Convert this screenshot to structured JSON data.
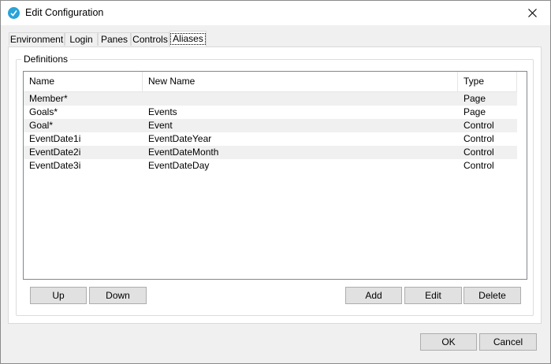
{
  "window": {
    "title": "Edit Configuration"
  },
  "tabs": [
    {
      "label": "Environment"
    },
    {
      "label": "Login"
    },
    {
      "label": "Panes"
    },
    {
      "label": "Controls"
    },
    {
      "label": "Aliases",
      "selected": true
    }
  ],
  "definitions": {
    "group_label": "Definitions",
    "columns": [
      "Name",
      "New Name",
      "Type"
    ],
    "rows": [
      {
        "name": "Member*",
        "new_name": "",
        "type": "Page"
      },
      {
        "name": "Goals*",
        "new_name": "Events",
        "type": "Page"
      },
      {
        "name": "Goal*",
        "new_name": "Event",
        "type": "Control"
      },
      {
        "name": "EventDate1i",
        "new_name": "EventDateYear",
        "type": "Control"
      },
      {
        "name": "EventDate2i",
        "new_name": "EventDateMonth",
        "type": "Control"
      },
      {
        "name": "EventDate3i",
        "new_name": "EventDateDay",
        "type": "Control"
      }
    ]
  },
  "buttons": {
    "up": "Up",
    "down": "Down",
    "add": "Add",
    "edit": "Edit",
    "delete": "Delete",
    "ok": "OK",
    "cancel": "Cancel"
  },
  "icons": {
    "app": "checkmark-circle-icon",
    "close": "close-icon"
  },
  "colors": {
    "accent": "#2aa3d8",
    "row_alt": "#f0f0f0"
  }
}
